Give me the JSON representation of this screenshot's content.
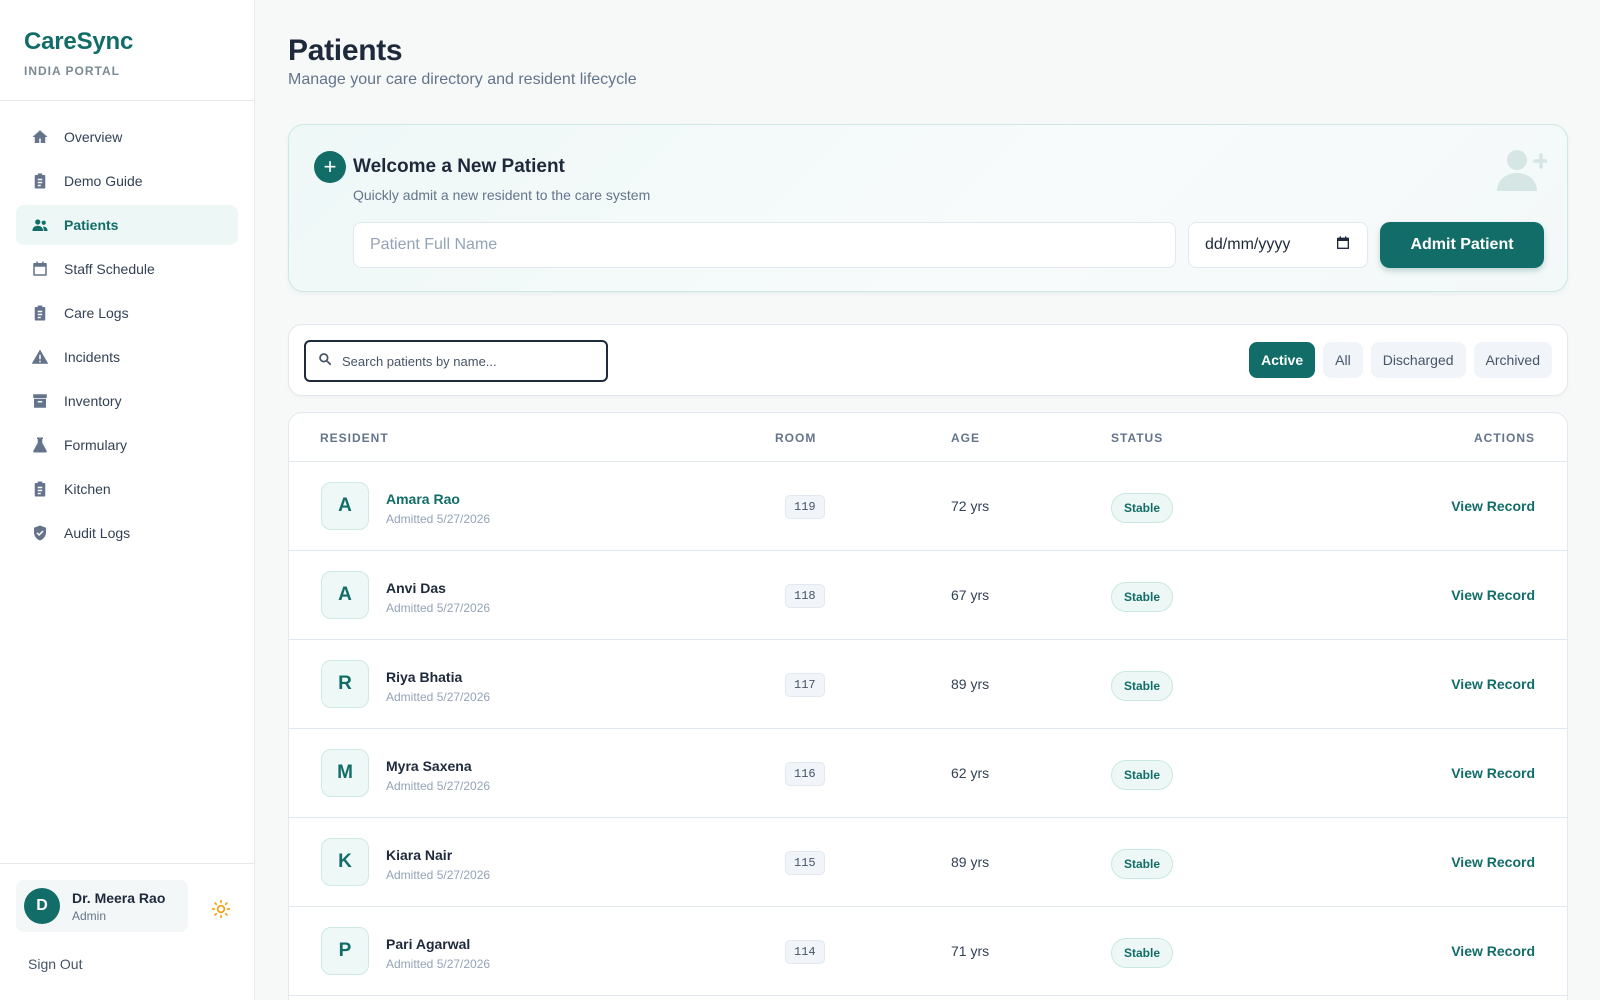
{
  "brand": {
    "name": "CareSync",
    "subtitle": "INDIA PORTAL"
  },
  "sidebar": {
    "items": [
      {
        "label": "Overview",
        "icon": "home-icon"
      },
      {
        "label": "Demo Guide",
        "icon": "clipboard-icon"
      },
      {
        "label": "Patients",
        "icon": "users-icon",
        "active": true
      },
      {
        "label": "Staff Schedule",
        "icon": "calendar-icon"
      },
      {
        "label": "Care Logs",
        "icon": "clipboard-icon"
      },
      {
        "label": "Incidents",
        "icon": "warning-icon"
      },
      {
        "label": "Inventory",
        "icon": "archive-icon"
      },
      {
        "label": "Formulary",
        "icon": "flask-icon"
      },
      {
        "label": "Kitchen",
        "icon": "clipboard-icon"
      },
      {
        "label": "Audit Logs",
        "icon": "shield-icon"
      }
    ]
  },
  "user": {
    "initial": "D",
    "name": "Dr. Meera Rao",
    "role": "Admin",
    "sign_out": "Sign Out"
  },
  "page": {
    "title": "Patients",
    "subtitle": "Manage your care directory and resident lifecycle"
  },
  "admit": {
    "title": "Welcome a New Patient",
    "subtitle": "Quickly admit a new resident to the care system",
    "name_placeholder": "Patient Full Name",
    "date_placeholder": "dd/mm/yyyy",
    "button": "Admit Patient"
  },
  "search": {
    "placeholder": "Search patients by name..."
  },
  "filters": [
    {
      "label": "Active",
      "active": true
    },
    {
      "label": "All"
    },
    {
      "label": "Discharged"
    },
    {
      "label": "Archived"
    }
  ],
  "table": {
    "headers": {
      "resident": "RESIDENT",
      "room": "ROOM",
      "age": "AGE",
      "status": "STATUS",
      "actions": "ACTIONS"
    },
    "rows": [
      {
        "initial": "A",
        "name": "Amara Rao",
        "admitted": "Admitted 5/27/2026",
        "room": "119",
        "age": "72 yrs",
        "status": "Stable",
        "action": "View Record"
      },
      {
        "initial": "A",
        "name": "Anvi Das",
        "admitted": "Admitted 5/27/2026",
        "room": "118",
        "age": "67 yrs",
        "status": "Stable",
        "action": "View Record"
      },
      {
        "initial": "R",
        "name": "Riya Bhatia",
        "admitted": "Admitted 5/27/2026",
        "room": "117",
        "age": "89 yrs",
        "status": "Stable",
        "action": "View Record"
      },
      {
        "initial": "M",
        "name": "Myra Saxena",
        "admitted": "Admitted 5/27/2026",
        "room": "116",
        "age": "62 yrs",
        "status": "Stable",
        "action": "View Record"
      },
      {
        "initial": "K",
        "name": "Kiara Nair",
        "admitted": "Admitted 5/27/2026",
        "room": "115",
        "age": "89 yrs",
        "status": "Stable",
        "action": "View Record"
      },
      {
        "initial": "P",
        "name": "Pari Agarwal",
        "admitted": "Admitted 5/27/2026",
        "room": "114",
        "age": "71 yrs",
        "status": "Stable",
        "action": "View Record"
      }
    ]
  },
  "colors": {
    "accent": "#126d68",
    "accent_light": "#ecf7f6",
    "theme_icon": "#f59e0b"
  }
}
